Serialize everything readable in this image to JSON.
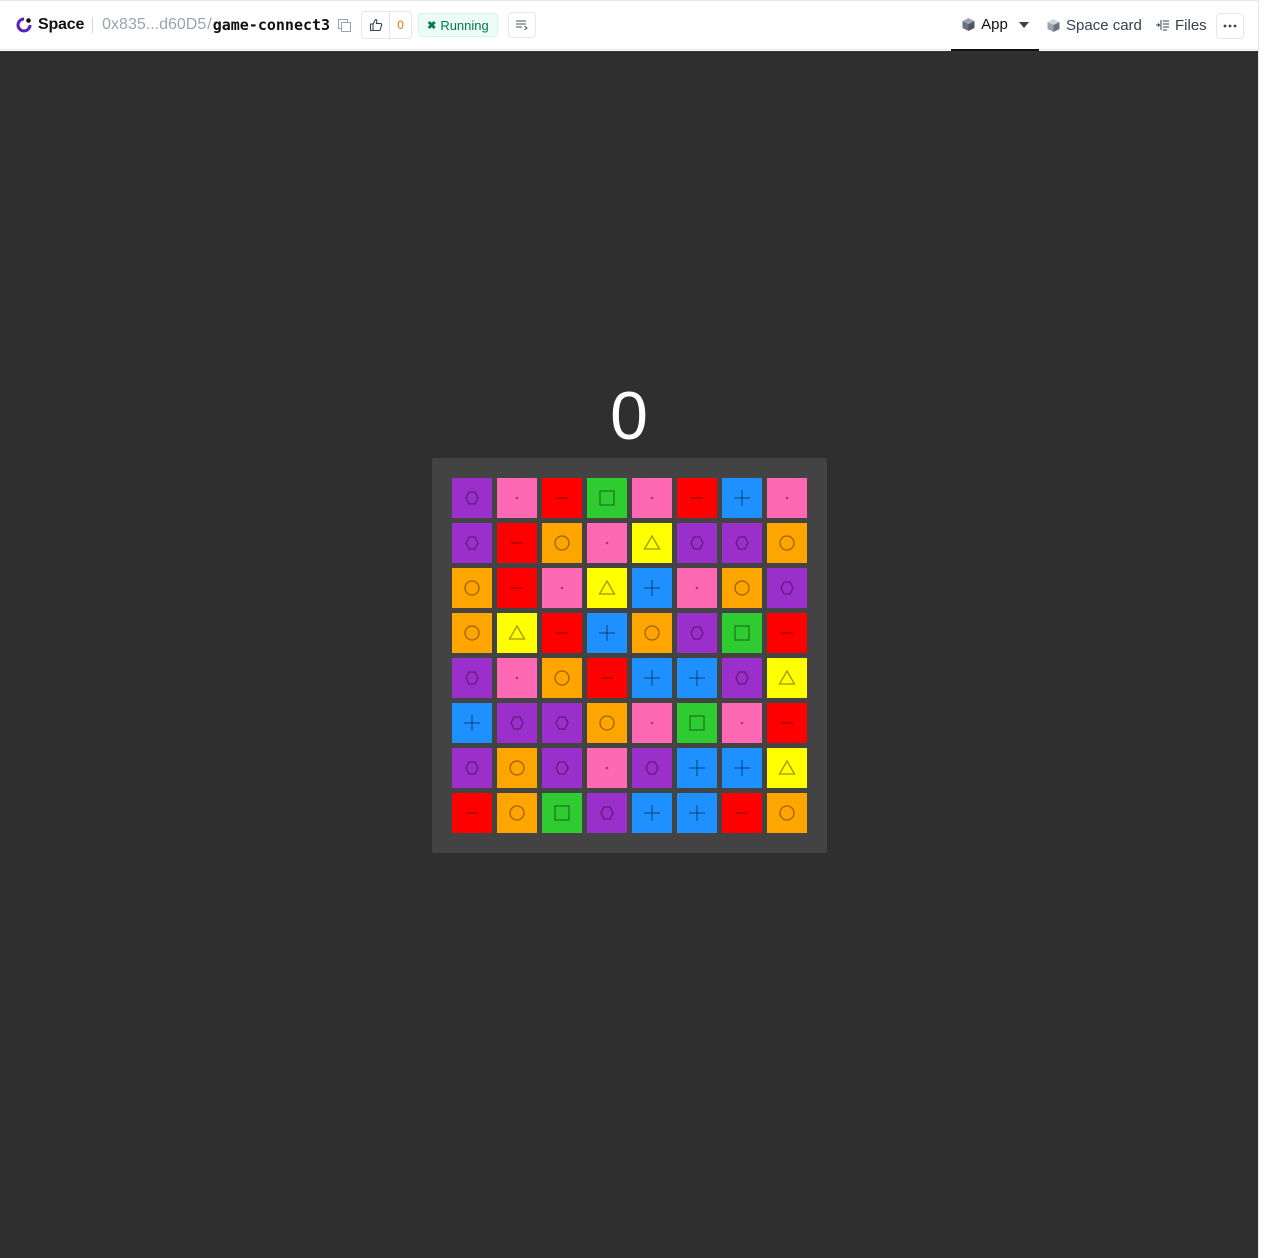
{
  "header": {
    "brand": "Space",
    "owner": "0x835...d60D5",
    "separator": "/",
    "repo": "game-connect3",
    "likes": "0",
    "status": "Running",
    "nav": {
      "app": "App",
      "space_card": "Space card",
      "files": "Files"
    },
    "icons": {
      "logo": "space-logo-icon",
      "copy": "copy-icon",
      "like": "thumbs-up-icon",
      "status": "running-icon",
      "logs": "logs-icon",
      "app": "cube-icon",
      "space_card": "cube-icon",
      "files": "files-icon",
      "more": "ellipsis-icon"
    }
  },
  "game": {
    "score": "0",
    "colors": {
      "hexagon": "#9b2fcb",
      "dot": "#ff69b4",
      "minus": "#ff0000",
      "square": "#2ecc31",
      "plus": "#1e90ff",
      "circle": "#ffa500",
      "triangle": "#ffff00"
    },
    "grid": [
      [
        "hexagon",
        "dot",
        "minus",
        "square",
        "dot",
        "minus",
        "plus",
        "dot"
      ],
      [
        "hexagon",
        "minus",
        "circle",
        "dot",
        "triangle",
        "hexagon",
        "hexagon",
        "circle"
      ],
      [
        "circle",
        "minus",
        "dot",
        "triangle",
        "plus",
        "dot",
        "circle",
        "hexagon"
      ],
      [
        "circle",
        "triangle",
        "minus",
        "plus",
        "circle",
        "hexagon",
        "square",
        "minus"
      ],
      [
        "hexagon",
        "dot",
        "circle",
        "minus",
        "plus",
        "plus",
        "hexagon",
        "triangle"
      ],
      [
        "plus",
        "hexagon",
        "hexagon",
        "circle",
        "dot",
        "square",
        "dot",
        "minus"
      ],
      [
        "hexagon",
        "circle",
        "hexagon",
        "dot",
        "hexagon",
        "plus",
        "plus",
        "triangle"
      ],
      [
        "minus",
        "circle",
        "square",
        "hexagon",
        "plus",
        "plus",
        "minus",
        "circle"
      ]
    ]
  }
}
